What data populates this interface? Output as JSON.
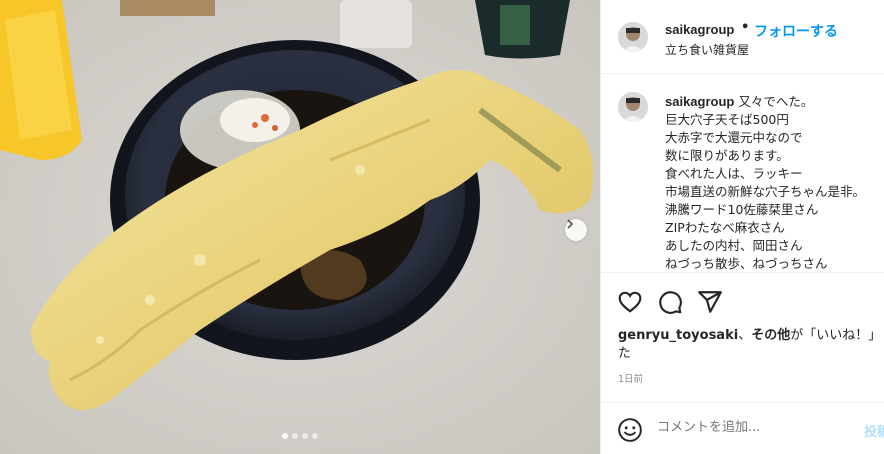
{
  "photo": {
    "dots_total": 4,
    "dots_active": 0
  },
  "header": {
    "username": "saikagroup",
    "separator": "•",
    "follow_label": "フォローする",
    "location": "立ち食い雑貨屋"
  },
  "caption": {
    "username": "saikagroup",
    "lines": [
      "又々でへた。",
      "巨大穴子天そば500円",
      "大赤字で大還元中なので",
      "数に限りがあります。",
      "食べれた人は、ラッキー",
      "市場直送の新鮮な穴子ちゃん是非。",
      "沸騰ワード10佐藤栞里さん",
      "ZIPわたなべ麻衣さん",
      "あしたの内村、岡田さん",
      "ねづっち散歩、ねづっちさん"
    ]
  },
  "actions": {
    "like_icon": "heart-icon",
    "comment_icon": "comment-icon",
    "share_icon": "paper-plane-icon"
  },
  "likes": {
    "user": "genryu_toyosaki",
    "connector": "、",
    "others": "その他",
    "suffix": "が「いいね！」し",
    "wrap": "た"
  },
  "time": "1日前",
  "comment": {
    "placeholder": "コメントを追加...",
    "post_label": "投稿"
  },
  "colors": {
    "accent": "#0095f6",
    "muted": "#8e8e8e",
    "border": "#efefef"
  }
}
